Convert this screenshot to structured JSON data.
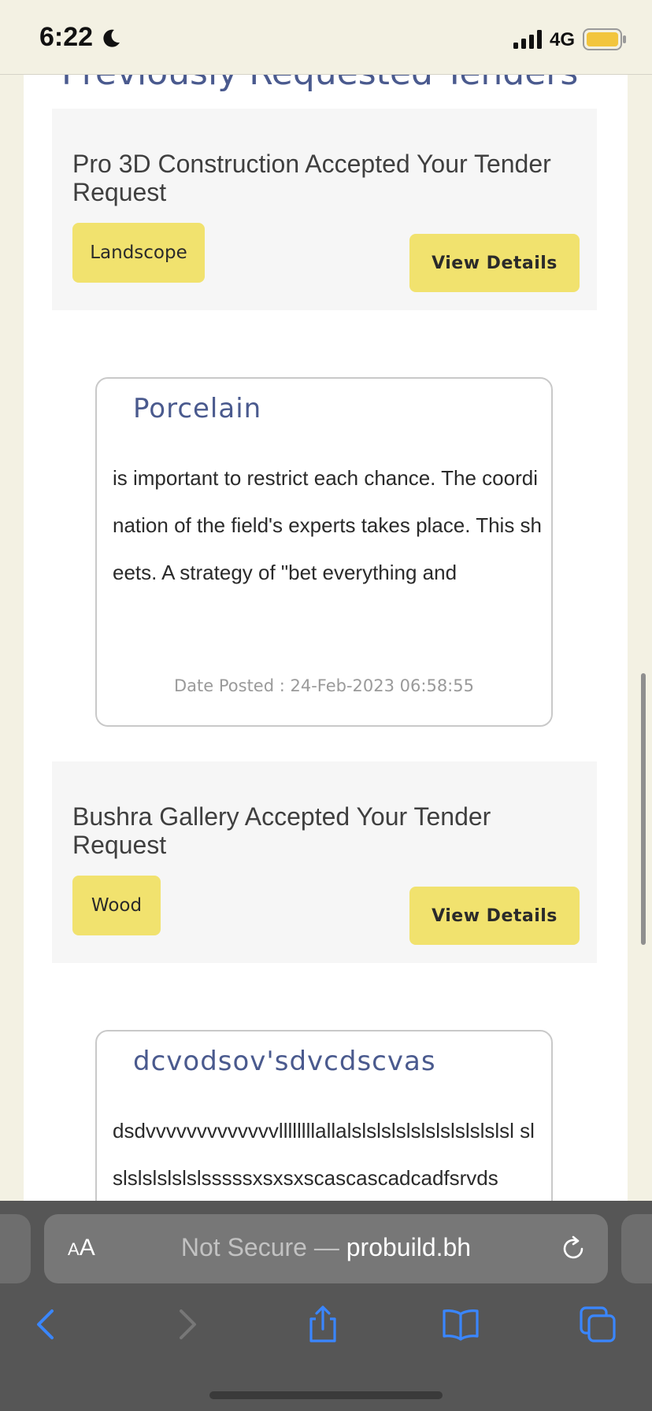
{
  "status_bar": {
    "time": "6:22",
    "network": "4G",
    "icons": [
      "moon-icon",
      "signal-icon",
      "battery-icon"
    ]
  },
  "page": {
    "section_heading": "Previously Requested Tenders",
    "tenders": [
      {
        "title": "Pro 3D Construction Accepted Your Tender Request",
        "category": "Landscope",
        "button_label": "View Details"
      },
      {
        "title": "Bushra Gallery Accepted Your Tender Request",
        "category": "Wood",
        "button_label": "View Details"
      }
    ],
    "posts": [
      {
        "title": "Porcelain",
        "body": "is important to restrict each chance. The coordination of the field's experts takes place. This sheets. A strategy of \"bet everything and",
        "date": "Date Posted : 24-Feb-2023 06:58:55"
      },
      {
        "title": "dcvodsov'sdvcdscvas",
        "body": "dsdvvvvvvvvvvvvvllllllllallalslslslslslslslslslslsl slslslslslslslsssssxsxsxscascascadcadfsrvds",
        "date": ""
      }
    ]
  },
  "browser": {
    "text_size_label_small": "A",
    "text_size_label_large": "A",
    "url_prefix": "Not Secure — ",
    "url_domain": "probuild.bh",
    "toolbar_icons": [
      "back-icon",
      "forward-icon",
      "share-icon",
      "bookmarks-icon",
      "tabs-icon"
    ]
  },
  "colors": {
    "accent_yellow": "#f1e26e",
    "heading_blue": "#4a5a8e",
    "page_background": "#f3f1e3",
    "safari_blue": "#3a86ff"
  }
}
